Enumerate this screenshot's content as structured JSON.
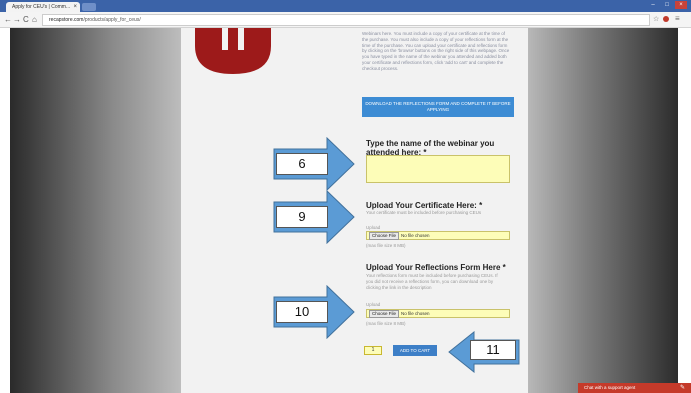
{
  "browser": {
    "tab_title": "Apply for CEU's | Comm...",
    "tab_close": "×",
    "url_domain": "recapstore.com",
    "url_path": "/products/apply_for_ceus/",
    "nav_back": "←",
    "nav_forward": "→",
    "nav_reload": "C",
    "nav_home": "⌂",
    "star_icon": "☆",
    "win_min": "–",
    "win_max": "□",
    "win_close": "×"
  },
  "intro": {
    "text": "Webinars here. You must include a copy of your certificate at the time of the purchase. You must also include a copy of your reflections form at the time of the purchase. You can upload your certificate and reflections form by clicking on the 'browse' buttons on the right side of this webpage. Once you have typed in the name of the webinar you attended and added both your certificate and reflections form, click 'add to cart' and complete the checkout process.",
    "download_button": "DOWNLOAD THE REFLECTIONS FORM AND COMPLETE IT BEFORE APPLYING"
  },
  "webinar": {
    "heading": "Type the name of the webinar you attended here: *"
  },
  "certificate": {
    "heading": "Upload Your Certificate Here: *",
    "note": "Your certificate must be included before purchasing CEUs",
    "upload_label": "Upload",
    "choose_label": "Choose File",
    "no_file": "No file chosen",
    "max_size": "(max file size 8 MB)"
  },
  "reflections": {
    "heading": "Upload Your Reflections Form Here *",
    "note": "Your reflections form must be included before purchasing CEUs. If you did not receive a reflections form, you can download one by clicking the link in the description",
    "upload_label": "Upload",
    "choose_label": "Choose File",
    "no_file": "No file chosen",
    "max_size": "(max file size 8 MB)"
  },
  "cart": {
    "quantity": "1",
    "add_to_cart": "ADD TO CART"
  },
  "chat": {
    "label": "Chat with a support agent"
  },
  "callouts": [
    "6",
    "9",
    "10",
    "11"
  ],
  "colors": {
    "arrow_fill": "#5b9bd5",
    "arrow_stroke": "#41719c",
    "input_fill": "#fdfdb8",
    "logo_red": "#9d1a1a",
    "button_blue": "#3d8cd4",
    "chat_red": "#c53a2a"
  }
}
